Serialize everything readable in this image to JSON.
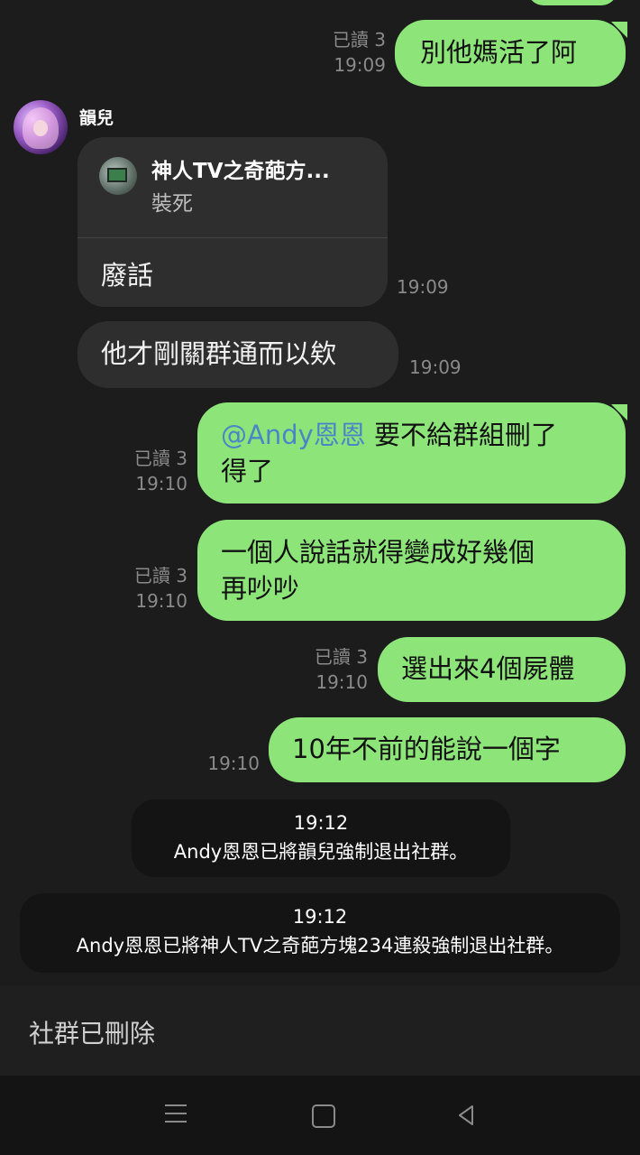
{
  "messages": {
    "m1": {
      "text": "別他媽活了阿",
      "read": "已讀 3",
      "time": "19:09"
    },
    "sender": {
      "name": "韻兒"
    },
    "reply": {
      "quote_title": "神人TV之奇葩方...",
      "quote_text": "裝死",
      "text": "廢話",
      "time": "19:09"
    },
    "m3": {
      "text": "他才剛關群通而以欸",
      "time": "19:09"
    },
    "m4": {
      "mention": "@Andy恩恩",
      "text_line1": " 要不給群組刪了",
      "text_line2": "得了",
      "read": "已讀 3",
      "time": "19:10"
    },
    "m5": {
      "line1": "一個人說話就得變成好幾個",
      "line2": "再吵吵",
      "read": "已讀 3",
      "time": "19:10"
    },
    "m6": {
      "text": "選出來4個屍體",
      "read": "已讀 3",
      "time": "19:10"
    },
    "m7": {
      "text": "10年不前的能說一個字",
      "time": "19:10"
    }
  },
  "system": {
    "s1": {
      "time": "19:12",
      "text": "Andy恩恩已將韻兒強制退出社群。"
    },
    "s2": {
      "time": "19:12",
      "text": "Andy恩恩已將神人TV之奇葩方塊234連殺強制退出社群。"
    }
  },
  "footer": {
    "deleted_label": "社群已刪除"
  },
  "nav": {
    "menu_icon": "menu-icon",
    "home_icon": "home-icon",
    "back_icon": "back-icon"
  }
}
